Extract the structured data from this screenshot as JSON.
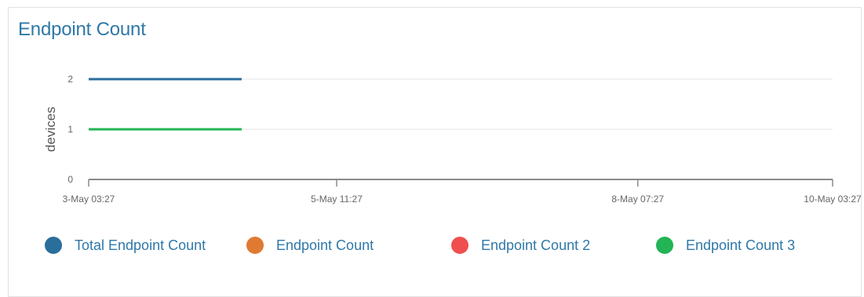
{
  "panel": {
    "title": "Endpoint Count"
  },
  "chart_data": {
    "type": "line",
    "title": "Endpoint Count",
    "xlabel": "",
    "ylabel": "devices",
    "x_tick_labels": [
      "3-May 03:27",
      "5-May 11:27",
      "8-May 07:27",
      "10-May 03:27"
    ],
    "x": [
      "3-May 03:27",
      "4-May 14:00"
    ],
    "ylim": [
      0,
      2
    ],
    "y_ticks": [
      0,
      1,
      2
    ],
    "grid": true,
    "legend_position": "bottom",
    "series": [
      {
        "name": "Total Endpoint Count",
        "color": "#2a6e9c",
        "x": [
          "3-May 03:27",
          "4-May 14:00"
        ],
        "values": [
          2,
          2
        ]
      },
      {
        "name": "Endpoint Count",
        "color": "#e07a32",
        "x": [],
        "values": []
      },
      {
        "name": "Endpoint Count 2",
        "color": "#ef4f4f",
        "x": [],
        "values": []
      },
      {
        "name": "Endpoint Count 3",
        "color": "#22b455",
        "x": [
          "3-May 03:27",
          "4-May 14:00"
        ],
        "values": [
          1,
          1
        ]
      }
    ]
  }
}
